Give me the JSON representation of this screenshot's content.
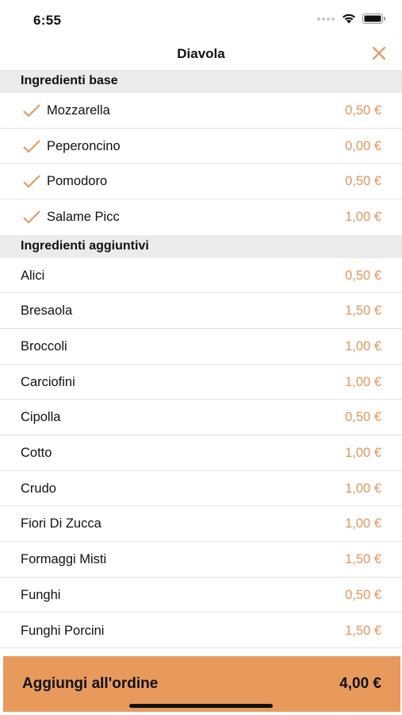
{
  "status": {
    "time": "6:55"
  },
  "nav": {
    "title": "Diavola"
  },
  "colors": {
    "accent": "#e8935a",
    "section_bg": "#ebebeb",
    "button_bg": "#e89a5c"
  },
  "base_section": {
    "title": "Ingredienti base",
    "items": [
      {
        "name": "Mozzarella",
        "price": "0,50 €",
        "checked": true
      },
      {
        "name": "Peperoncino",
        "price": "0,00 €",
        "checked": true
      },
      {
        "name": "Pomodoro",
        "price": "0,50 €",
        "checked": true
      },
      {
        "name": "Salame Picc",
        "price": "1,00 €",
        "checked": true
      }
    ]
  },
  "extra_section": {
    "title": "Ingredienti aggiuntivi",
    "items": [
      {
        "name": "Alici",
        "price": "0,50 €"
      },
      {
        "name": "Bresaola",
        "price": "1,50 €"
      },
      {
        "name": "Broccoli",
        "price": "1,00 €"
      },
      {
        "name": "Carciofini",
        "price": "1,00 €"
      },
      {
        "name": "Cipolla",
        "price": "0,50 €"
      },
      {
        "name": "Cotto",
        "price": "1,00 €"
      },
      {
        "name": "Crudo",
        "price": "1,00 €"
      },
      {
        "name": "Fiori Di Zucca",
        "price": "1,00 €"
      },
      {
        "name": "Formaggi Misti",
        "price": "1,50 €"
      },
      {
        "name": "Funghi",
        "price": "0,50 €"
      },
      {
        "name": "Funghi Porcini",
        "price": "1,50 €"
      }
    ]
  },
  "footer": {
    "label": "Aggiungi all'ordine",
    "total": "4,00 €"
  }
}
